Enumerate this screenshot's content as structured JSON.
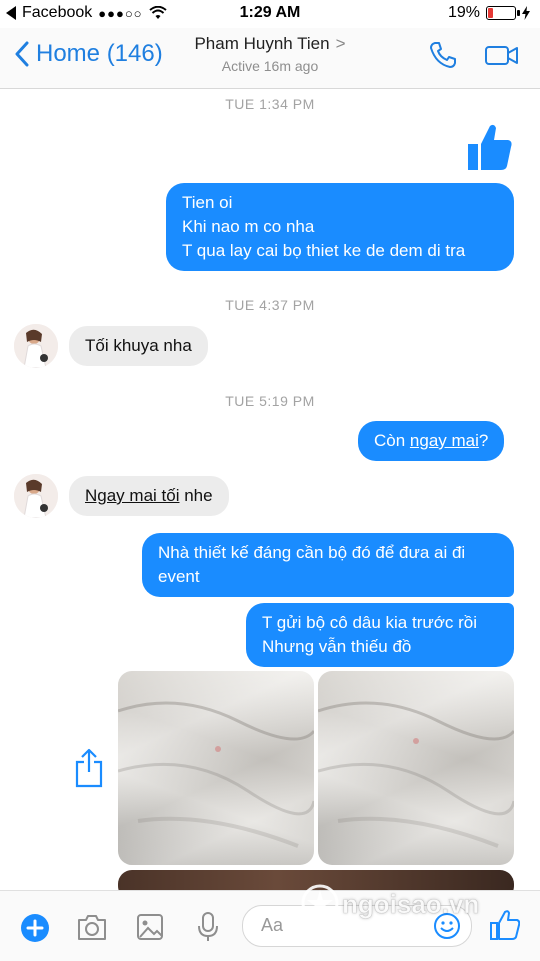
{
  "status_bar": {
    "carrier": "Facebook",
    "signal": "●●●○○",
    "time": "1:29 AM",
    "battery": "19%",
    "battery_level": 0.19
  },
  "nav": {
    "back_label": "Home (146)",
    "contact_name": "Pham Huynh Tien",
    "active_status": "Active 16m ago"
  },
  "messages": {
    "ts1": "TUE 1:34 PM",
    "msg1": [
      "Tien oi",
      "Khi nao m co nha",
      "T qua lay cai bọ thiet ke de dem di tra"
    ],
    "ts2": "TUE 4:37 PM",
    "reply1": "Tối khuya nha",
    "ts3": "TUE 5:19 PM",
    "msg2_prefix": "Còn ",
    "msg2_link": "ngay mai",
    "msg2_suffix": "?",
    "reply2": "Ngay mai tối",
    "reply2_suffix": " nhe",
    "msg3": [
      "Nhà thiết kế đáng cần bộ đó để đưa ai đi",
      "event"
    ],
    "msg4": [
      "T gửi bộ cô dâu kia trước rồi",
      "Nhưng vẫn thiếu đồ"
    ]
  },
  "composer": {
    "placeholder": "Aa"
  },
  "watermark": "ngoisao.vn",
  "colors": {
    "accent": "#1a8cff",
    "nav_blue": "#1f7fe0",
    "incoming": "#ececec"
  }
}
